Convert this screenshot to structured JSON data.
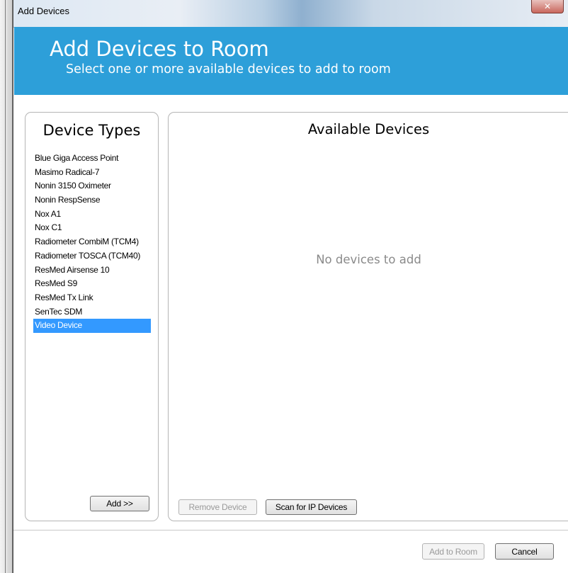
{
  "window": {
    "title": "Add Devices",
    "close_label": "✕"
  },
  "banner": {
    "title": "Add Devices to Room",
    "subtitle": "Select one or more available devices to add to room"
  },
  "device_types": {
    "title": "Device Types",
    "items": [
      "Blue Giga Access Point",
      "Masimo Radical-7",
      "Nonin 3150 Oximeter",
      "Nonin RespSense",
      "Nox A1",
      "Nox C1",
      "Radiometer CombiM (TCM4)",
      "Radiometer TOSCA (TCM40)",
      "ResMed Airsense 10",
      "ResMed S9",
      "ResMed Tx Link",
      "SenTec SDM",
      "Video Device"
    ],
    "selected_index": 12,
    "add_button": "Add >>"
  },
  "available_devices": {
    "title": "Available Devices",
    "empty_message": "No devices to add",
    "remove_button": "Remove Device",
    "scan_button": "Scan for IP Devices"
  },
  "footer": {
    "add_to_room_button": "Add to Room",
    "cancel_button": "Cancel"
  },
  "colors": {
    "banner": "#2d9fd9",
    "selection": "#3399ff"
  }
}
